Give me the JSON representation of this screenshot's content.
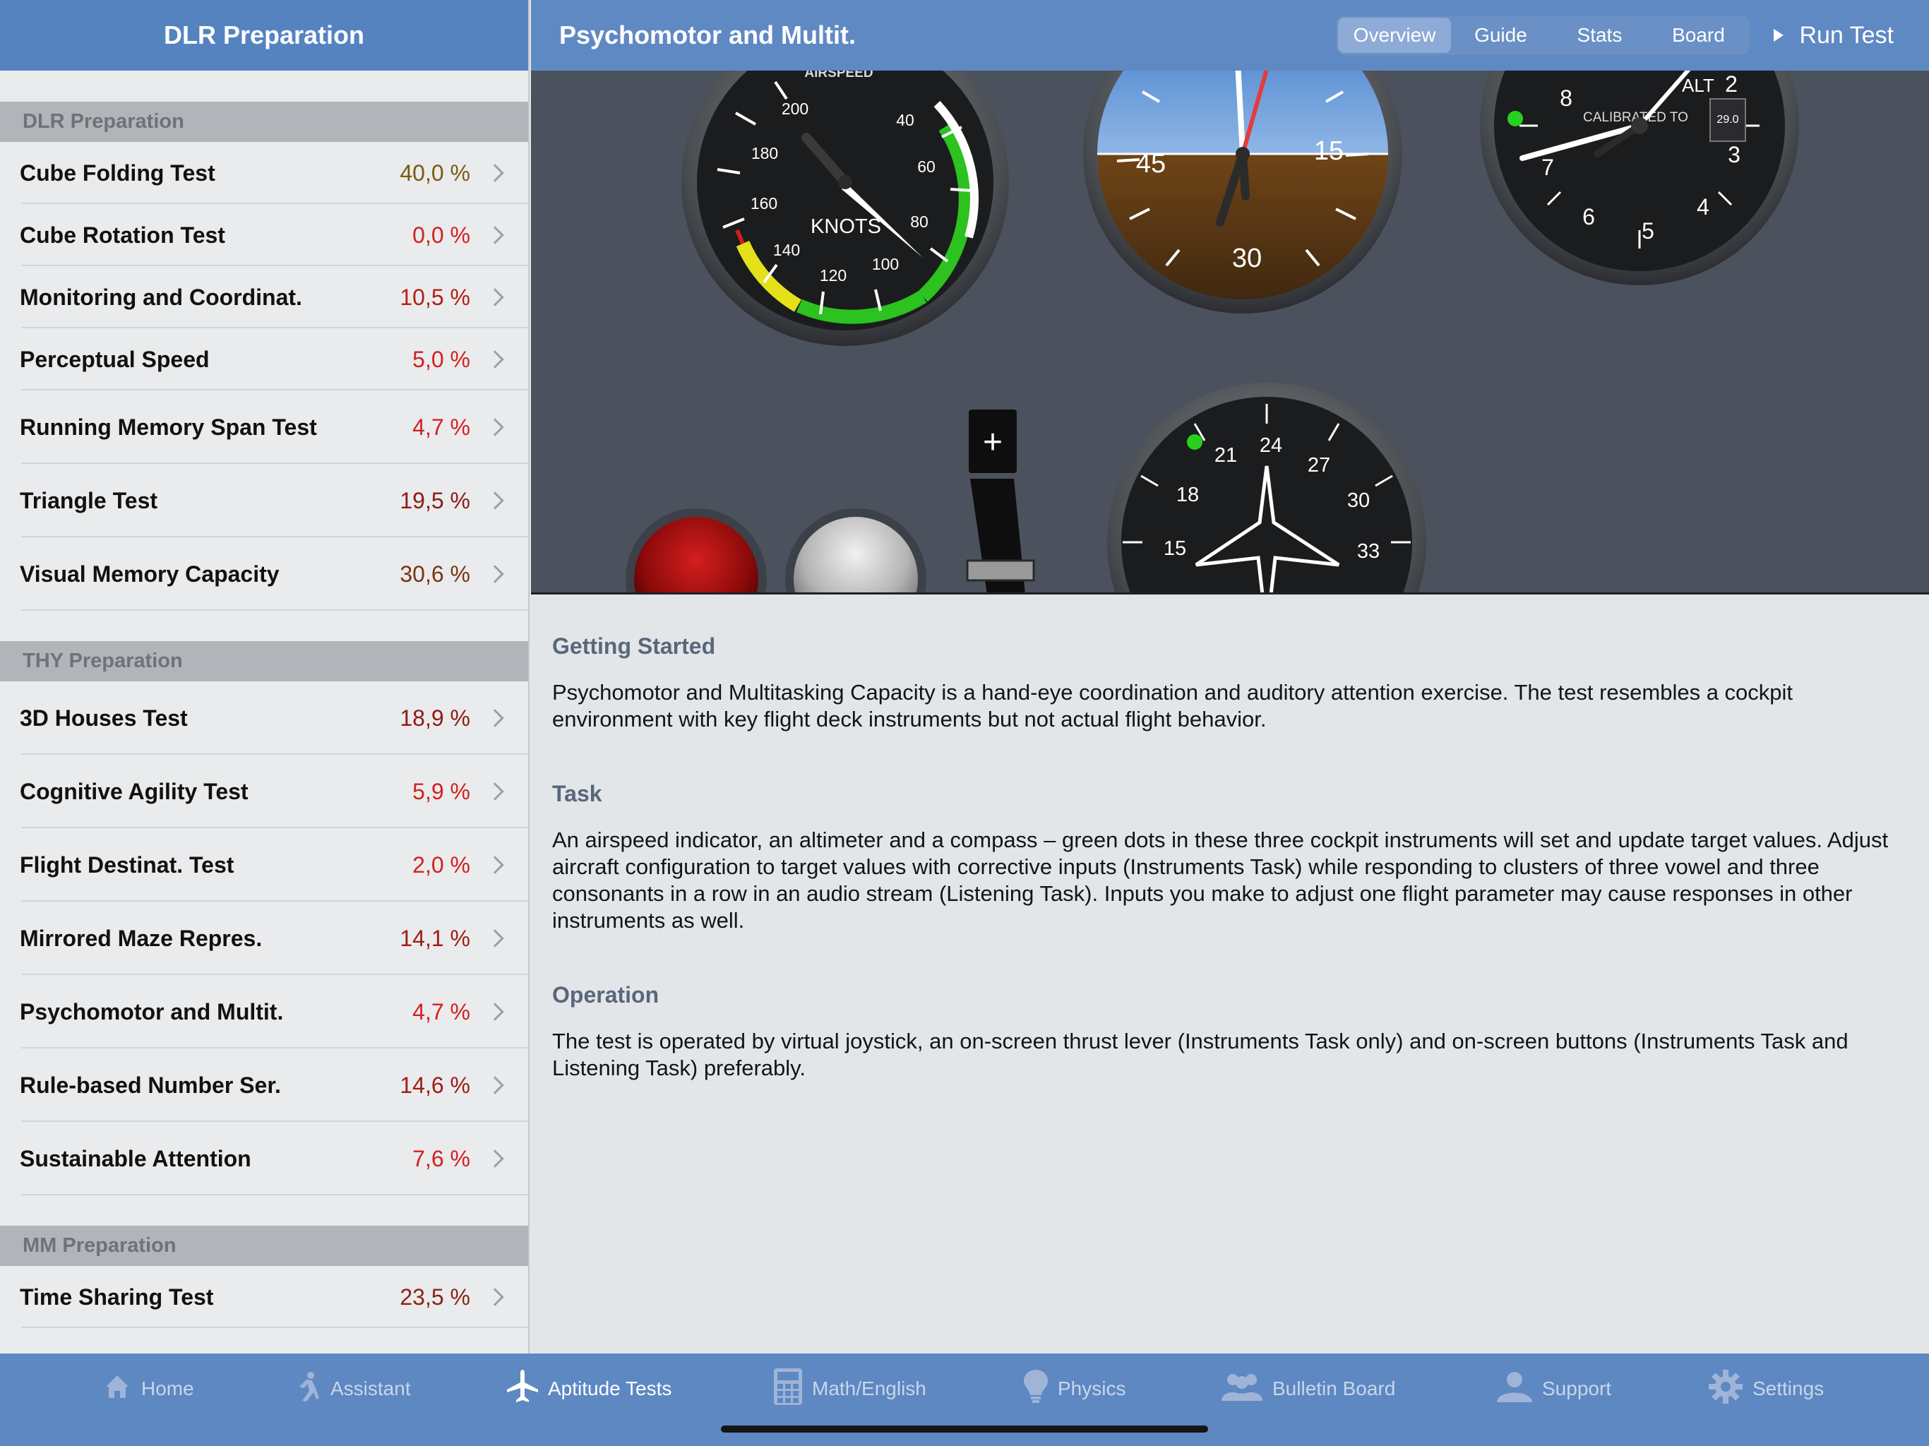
{
  "sidebar": {
    "title": "DLR Preparation",
    "sections": [
      {
        "title": "DLR Preparation",
        "items": [
          {
            "label": "Cube Folding Test",
            "value": "40,0 %",
            "color": "#7a5a12"
          },
          {
            "label": "Cube Rotation Test",
            "value": "0,0 %",
            "color": "#d51f1f"
          },
          {
            "label": "Monitoring and Coordinat.",
            "value": "10,5 %",
            "color": "#b51e12"
          },
          {
            "label": "Perceptual Speed",
            "value": "5,0 %",
            "color": "#d51f1f"
          },
          {
            "label": "Running Memory Span Test",
            "value": "4,7 %",
            "color": "#d51f1f"
          },
          {
            "label": "Triangle Test",
            "value": "19,5 %",
            "color": "#8e1a12"
          },
          {
            "label": "Visual Memory Capacity",
            "value": "30,6 %",
            "color": "#7a3412"
          }
        ]
      },
      {
        "title": "THY Preparation",
        "items": [
          {
            "label": "3D Houses Test",
            "value": "18,9 %",
            "color": "#8e1a12"
          },
          {
            "label": "Cognitive Agility Test",
            "value": "5,9 %",
            "color": "#d51f1f"
          },
          {
            "label": "Flight Destinat. Test",
            "value": "2,0 %",
            "color": "#d51f1f"
          },
          {
            "label": "Mirrored Maze Repres.",
            "value": "14,1 %",
            "color": "#a01c12"
          },
          {
            "label": "Psychomotor and Multit.",
            "value": "4,7 %",
            "color": "#d51f1f"
          },
          {
            "label": "Rule-based Number Ser.",
            "value": "14,6 %",
            "color": "#a01c12"
          },
          {
            "label": "Sustainable Attention",
            "value": "7,6 %",
            "color": "#d51f1f"
          }
        ]
      },
      {
        "title": "MM Preparation",
        "items": [
          {
            "label": "Time Sharing Test",
            "value": "23,5 %",
            "color": "#8a2412"
          }
        ]
      }
    ]
  },
  "header": {
    "title": "Psychomotor and Multit.",
    "segments": [
      "Overview",
      "Guide",
      "Stats",
      "Board"
    ],
    "active_segment": "Overview",
    "run_label": "Run Test"
  },
  "panel": {
    "airspeed_label": "AIRSPEED",
    "knots_label": "KNOTS",
    "airspeed_ticks": [
      "200",
      "180",
      "160",
      "140",
      "120",
      "100",
      "80",
      "60",
      "40"
    ],
    "attitude_ticks": [
      "45",
      "15",
      "30"
    ],
    "altimeter_label": "ALT",
    "calibrated_label": "CALIBRATED TO",
    "altimeter_ticks": [
      "8",
      "2",
      "7",
      "3",
      "6",
      "5",
      "4"
    ],
    "compass_ticks": [
      "24",
      "21",
      "27",
      "18",
      "30",
      "15",
      "33"
    ]
  },
  "content": {
    "sections": [
      {
        "heading": "Getting Started",
        "body": "Psychomotor and Multitasking Capacity is a hand-eye coordination and auditory attention exercise. The test resembles a cockpit environment with key flight deck instruments but not actual flight behavior."
      },
      {
        "heading": "Task",
        "body": "An airspeed indicator, an altimeter and a compass – green dots in these three cockpit instruments will set and update target values. Adjust aircraft configuration to target values with corrective inputs (Instruments Task) while responding to clusters of three vowel and three consonants in a row in an audio stream (Listening Task). Inputs you make to adjust one flight parameter may cause responses in other instruments as well."
      },
      {
        "heading": "Operation",
        "body": "The test is operated by virtual joystick, an on-screen thrust lever (Instruments Task only) and on-screen buttons (Instruments Task and Listening Task) preferably."
      }
    ]
  },
  "tabbar": {
    "tabs": [
      {
        "label": "Home",
        "icon": "home-icon"
      },
      {
        "label": "Assistant",
        "icon": "runner-icon"
      },
      {
        "label": "Aptitude Tests",
        "icon": "airplane-icon"
      },
      {
        "label": "Math/English",
        "icon": "calculator-icon"
      },
      {
        "label": "Physics",
        "icon": "lightbulb-icon"
      },
      {
        "label": "Bulletin Board",
        "icon": "people-icon"
      },
      {
        "label": "Support",
        "icon": "person-icon"
      },
      {
        "label": "Settings",
        "icon": "gear-icon"
      }
    ],
    "active": "Aptitude Tests"
  },
  "colors": {
    "accent": "#5583c0",
    "header_main": "#5f89c3",
    "panel_bg": "#4c525d",
    "gauge_green": "#2cc21f",
    "gauge_yellow": "#e4e01a",
    "gauge_red": "#d41c1c"
  }
}
